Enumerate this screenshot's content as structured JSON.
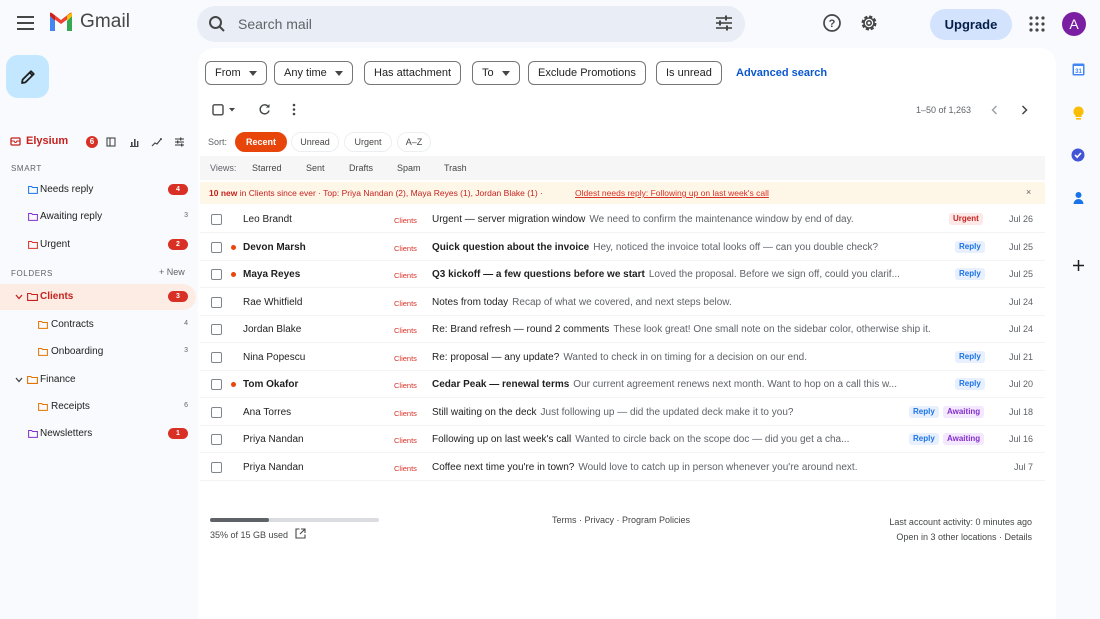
{
  "app": {
    "name": "Gmail",
    "avatar_letter": "A",
    "upgrade_label": "Upgrade"
  },
  "search": {
    "placeholder": "Search mail"
  },
  "account": {
    "name": "Elysium",
    "badge": "6"
  },
  "sidebar": {
    "smart_label": "SMART",
    "smart": [
      {
        "label": "Needs reply",
        "count": "4"
      },
      {
        "label": "Awaiting reply",
        "count": "3"
      },
      {
        "label": "Urgent",
        "count": "2"
      }
    ],
    "folders_label": "FOLDERS",
    "new_label": "+ New",
    "folders": [
      {
        "label": "Clients",
        "count": "3"
      },
      {
        "label": "Contracts",
        "count": "4"
      },
      {
        "label": "Onboarding",
        "count": "3"
      },
      {
        "label": "Finance"
      },
      {
        "label": "Receipts",
        "count": "6"
      },
      {
        "label": "Newsletters",
        "count": "1"
      }
    ]
  },
  "filters": {
    "chips": [
      "From",
      "Any time",
      "Has attachment",
      "To",
      "Exclude Promotions",
      "Is unread"
    ],
    "advanced": "Advanced search"
  },
  "pagination": {
    "range": "1–50 of 1,263"
  },
  "sort": {
    "label": "Sort:",
    "options": [
      "Recent",
      "Unread",
      "Urgent",
      "A–Z"
    ]
  },
  "views": {
    "label": "Views:",
    "items": [
      "Starred",
      "Sent",
      "Drafts",
      "Spam",
      "Trash"
    ]
  },
  "banner": {
    "count_text": "10 new",
    "rest_text": " in Clients since ever · Top: Priya Nandan (2), Maya Reyes (1), Jordan Blake (1) · ",
    "oldest": "Oldest needs reply: Following up on last week's call",
    "close": "×"
  },
  "emails": [
    {
      "sender": "Leo Brandt",
      "label": "Clients",
      "subject": "Urgent — server migration window",
      "snippet": "We need to confirm the maintenance window by end of day.",
      "tags": [
        "Urgent"
      ],
      "date": "Jul 26",
      "unread": false
    },
    {
      "sender": "Devon Marsh",
      "label": "Clients",
      "subject": "Quick question about the invoice",
      "snippet": "Hey, noticed the invoice total looks off — can you double check?",
      "tags": [
        "Reply"
      ],
      "date": "Jul 25",
      "unread": true
    },
    {
      "sender": "Maya Reyes",
      "label": "Clients",
      "subject": "Q3 kickoff — a few questions before we start",
      "snippet": "Loved the proposal. Before we sign off, could you clarif...",
      "tags": [
        "Reply"
      ],
      "date": "Jul 25",
      "unread": true
    },
    {
      "sender": "Rae Whitfield",
      "label": "Clients",
      "subject": "Notes from today",
      "snippet": "Recap of what we covered, and next steps below.",
      "tags": [],
      "date": "Jul 24",
      "unread": false
    },
    {
      "sender": "Jordan Blake",
      "label": "Clients",
      "subject": "Re: Brand refresh — round 2 comments",
      "snippet": "These look great! One small note on the sidebar color, otherwise ship it.",
      "tags": [],
      "date": "Jul 24",
      "unread": false
    },
    {
      "sender": "Nina Popescu",
      "label": "Clients",
      "subject": "Re: proposal — any update?",
      "snippet": "Wanted to check in on timing for a decision on our end.",
      "tags": [
        "Reply"
      ],
      "date": "Jul 21",
      "unread": false
    },
    {
      "sender": "Tom Okafor",
      "label": "Clients",
      "subject": "Cedar Peak — renewal terms",
      "snippet": "Our current agreement renews next month. Want to hop on a call this w...",
      "tags": [
        "Reply"
      ],
      "date": "Jul 20",
      "unread": true
    },
    {
      "sender": "Ana Torres",
      "label": "Clients",
      "subject": "Still waiting on the deck",
      "snippet": "Just following up — did the updated deck make it to you?",
      "tags": [
        "Reply",
        "Awaiting"
      ],
      "date": "Jul 18",
      "unread": false
    },
    {
      "sender": "Priya Nandan",
      "label": "Clients",
      "subject": "Following up on last week's call",
      "snippet": "Wanted to circle back on the scope doc — did you get a cha...",
      "tags": [
        "Reply",
        "Awaiting"
      ],
      "date": "Jul 16",
      "unread": false
    },
    {
      "sender": "Priya Nandan",
      "label": "Clients",
      "subject": "Coffee next time you're in town?",
      "snippet": "Would love to catch up in person whenever you're around next.",
      "tags": [],
      "date": "Jul 7",
      "unread": false
    }
  ],
  "footer": {
    "storage_text": "35% of 15 GB used",
    "storage_fraction": 0.35,
    "links": "Terms · Privacy · Program Policies",
    "activity": "Last account activity: 0 minutes ago",
    "other_locations": "Open in 3 other locations · ",
    "details": "Details"
  },
  "colors": {
    "accent": "#e8450a",
    "gmail_red": "#ea4335",
    "compose_bg": "#c2e7ff"
  },
  "icons": [
    "menu-icon",
    "search-icon",
    "tune-icon",
    "help-icon",
    "settings-icon",
    "apps-icon",
    "pencil-icon",
    "calendar-icon",
    "keep-icon",
    "tasks-icon",
    "contacts-icon",
    "plus-icon"
  ]
}
